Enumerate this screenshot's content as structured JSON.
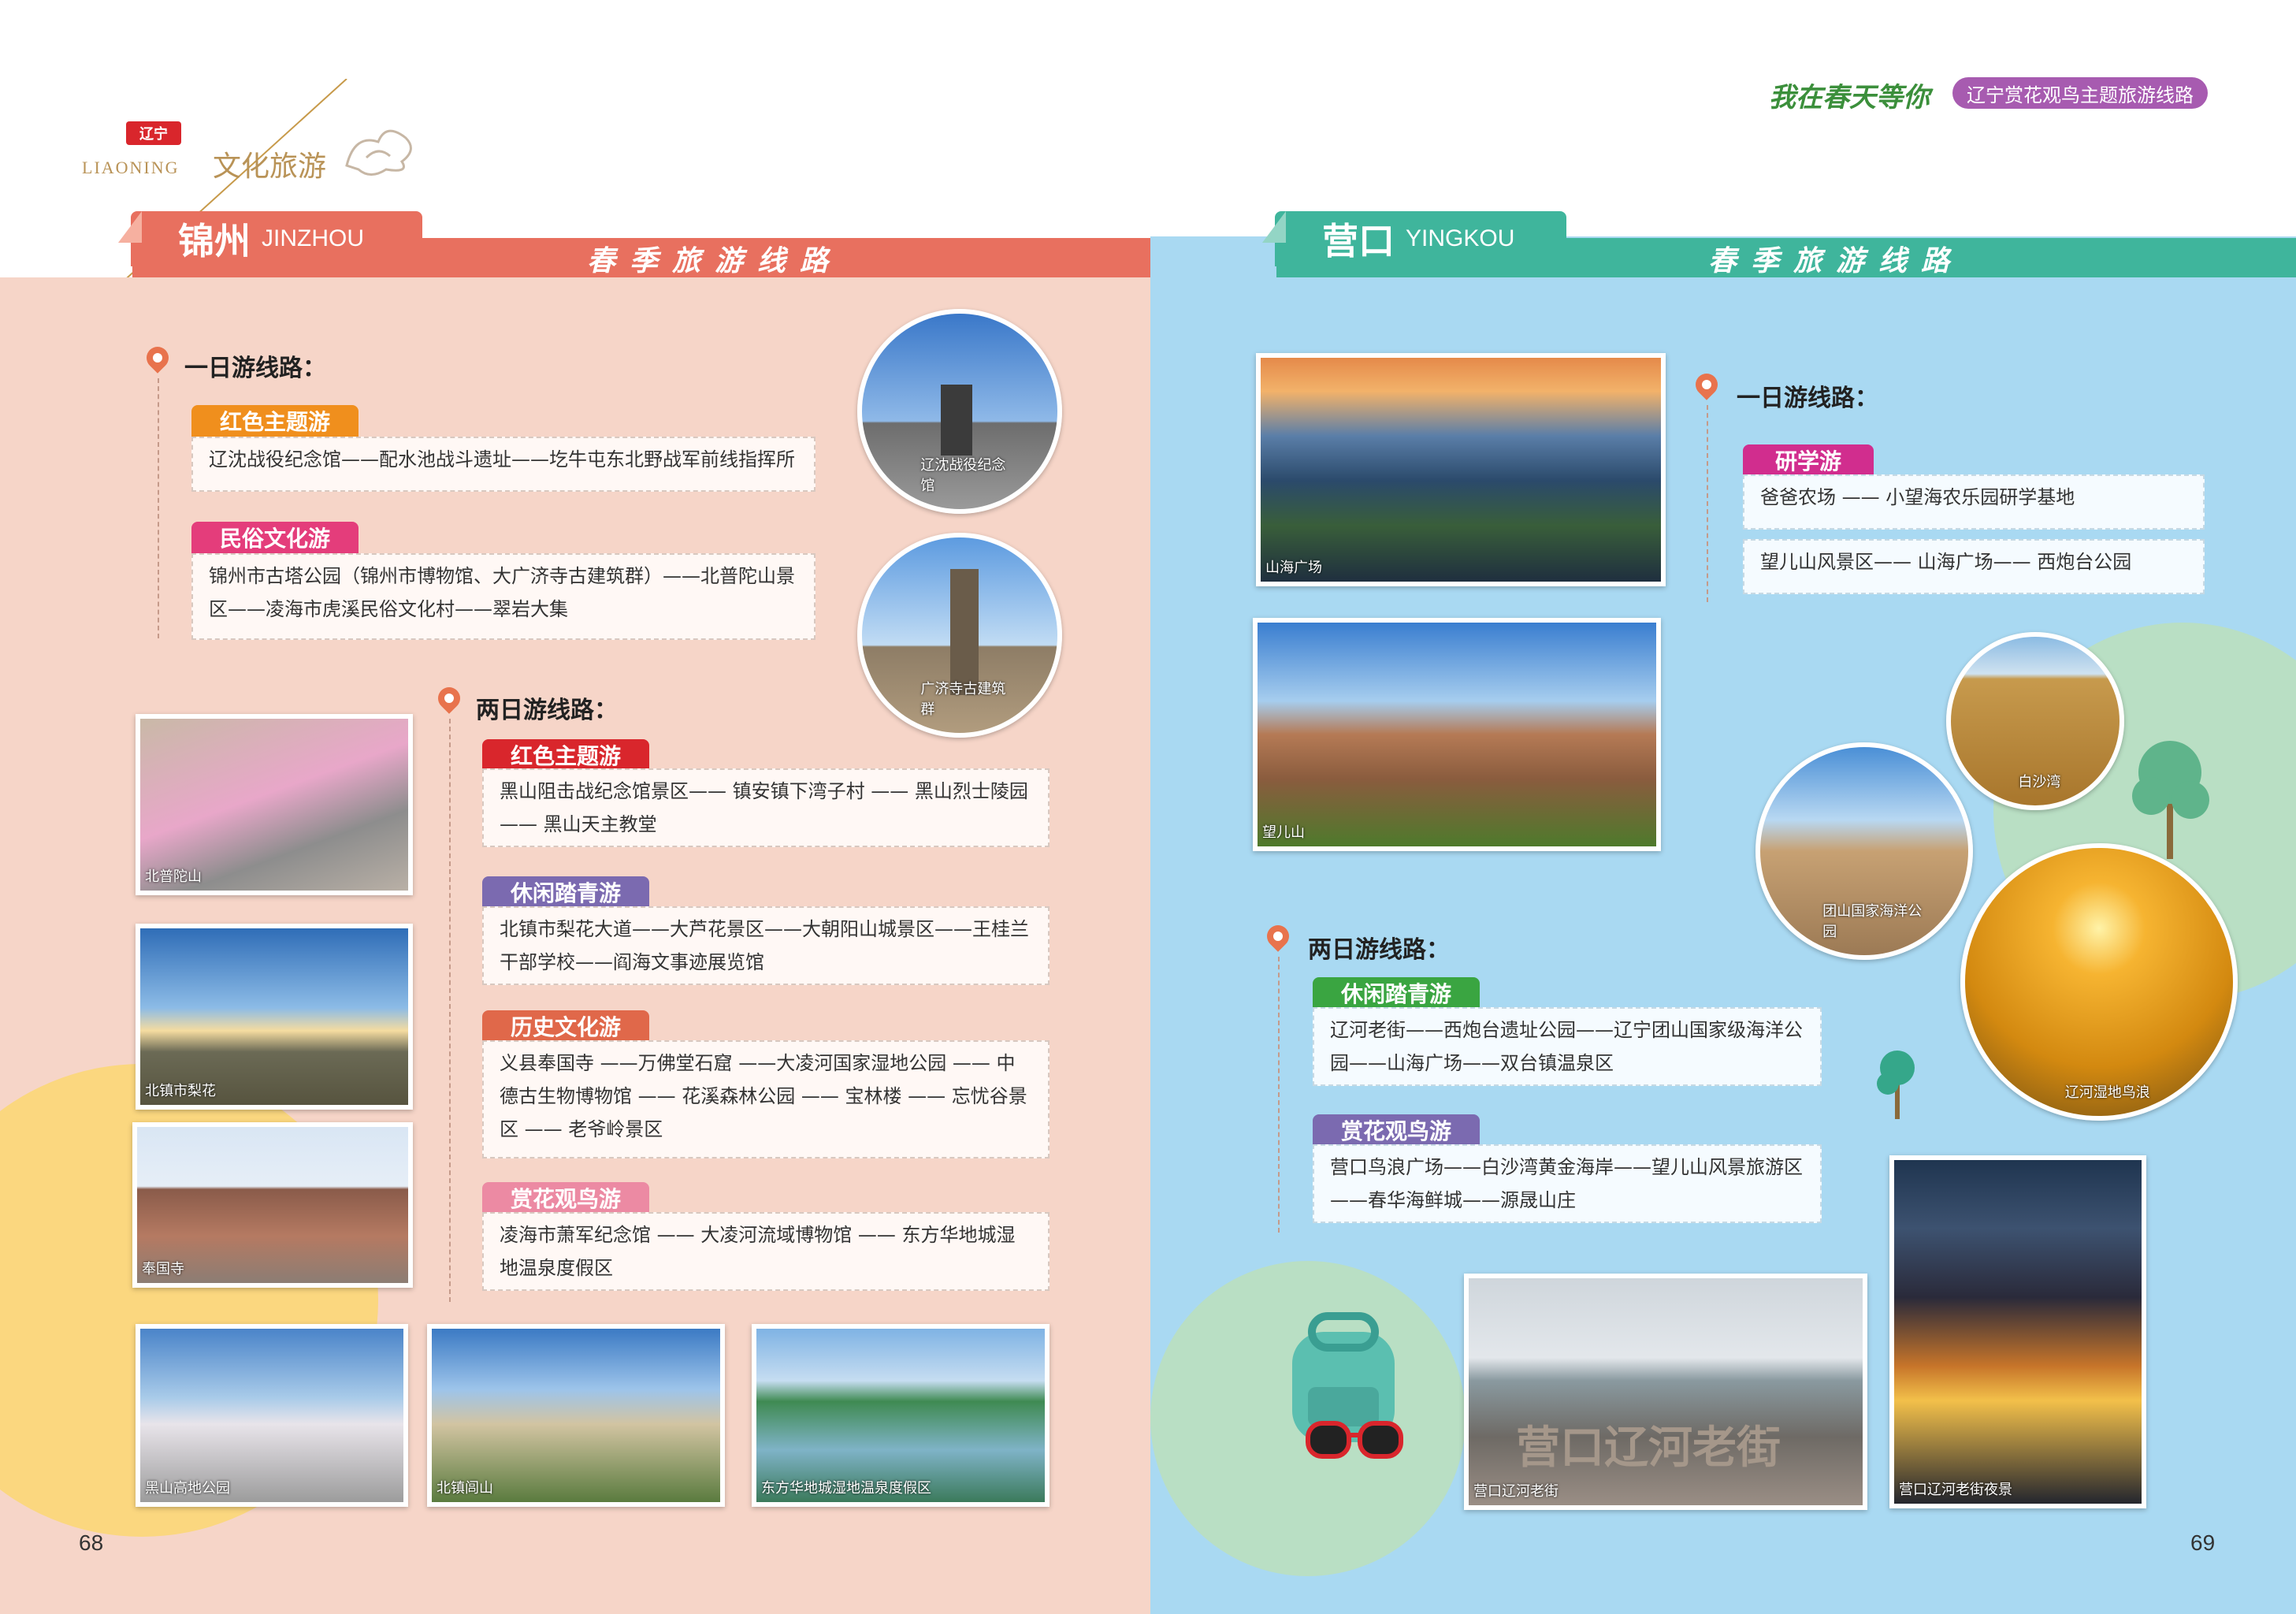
{
  "header": {
    "logo_cn": "辽宁",
    "logo_en": "LIAONING",
    "logo_text": "文化旅游",
    "slogan": "我在春天等你",
    "theme": "辽宁赏花观鸟主题旅游线路"
  },
  "left": {
    "city_cn": "锦州",
    "city_en": "JINZHOU",
    "season": "春季旅游线路",
    "one_day_title": "一日游线路：",
    "one_day": [
      {
        "tag": "红色主题游",
        "text": "辽沈战役纪念馆——配水池战斗遗址——圪牛屯东北野战军前线指挥所"
      },
      {
        "tag": "民俗文化游",
        "text": "锦州市古塔公园（锦州市博物馆、大广济寺古建筑群）——北普陀山景区——凌海市虎溪民俗文化村——翠岩大集"
      }
    ],
    "two_day_title": "两日游线路：",
    "two_day": [
      {
        "tag": "红色主题游",
        "text": "黑山阻击战纪念馆景区—— 镇安镇下湾子村 —— 黑山烈士陵园 —— 黑山天主教堂"
      },
      {
        "tag": "休闲踏青游",
        "text": "北镇市梨花大道——大芦花景区——大朝阳山城景区——王桂兰干部学校——阎海文事迹展览馆"
      },
      {
        "tag": "历史文化游",
        "text": "义县奉国寺 ——万佛堂石窟 ——大凌河国家湿地公园 —— 中德古生物博物馆 —— 花溪森林公园 —— 宝林楼 —— 忘忧谷景区 —— 老爷岭景区"
      },
      {
        "tag": "赏花观鸟游",
        "text": "凌海市萧军纪念馆 —— 大凌河流域博物馆 —— 东方华地城湿地温泉度假区"
      }
    ],
    "photos": [
      "辽沈战役纪念馆",
      "广济寺古建筑群",
      "北普陀山",
      "北镇市梨花",
      "奉国寺",
      "黑山高地公园",
      "北镇闾山",
      "东方华地城湿地温泉度假区"
    ],
    "page_number": "68"
  },
  "right": {
    "city_cn": "营口",
    "city_en": "YINGKOU",
    "season": "春季旅游线路",
    "one_day_title": "一日游线路：",
    "one_day_tag": "研学游",
    "one_day": [
      "爸爸农场 —— 小望海农乐园研学基地",
      "望儿山风景区—— 山海广场—— 西炮台公园"
    ],
    "two_day_title": "两日游线路：",
    "two_day": [
      {
        "tag": "休闲踏青游",
        "text": "辽河老街——西炮台遗址公园——辽宁团山国家级海洋公园——山海广场——双台镇温泉区"
      },
      {
        "tag": "赏花观鸟游",
        "text": "营口鸟浪广场——白沙湾黄金海岸——望儿山风景旅游区——春华海鲜城——源晟山庄"
      }
    ],
    "photos": [
      "山海广场",
      "望儿山",
      "白沙湾",
      "团山国家海洋公园",
      "辽河湿地鸟浪",
      "营口辽河老街",
      "营口辽河老街夜景"
    ],
    "sign_text": "营口辽河老街",
    "page_number": "69"
  },
  "colors": {
    "jinzhou": "#e8705f",
    "yingkou": "#3fb59c",
    "red_tag": "#d9262c",
    "orange_tag": "#f08f1d",
    "pink_tag": "#e43d7b",
    "purple_tag": "#7b6ab0",
    "brown_tag": "#e0684a",
    "rose_tag": "#ec8aa3",
    "green_tag": "#3aa541",
    "magenta_tag": "#d12d8e"
  }
}
